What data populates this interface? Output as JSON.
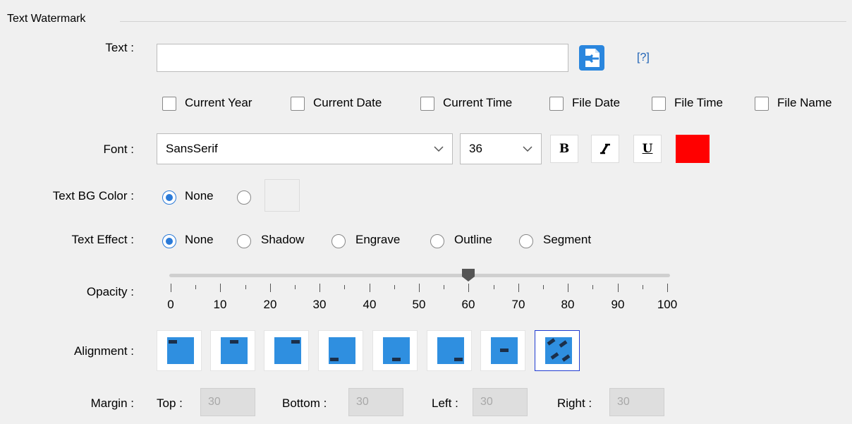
{
  "group_title": "Text Watermark",
  "labels": {
    "text": "Text :",
    "font": "Font :",
    "text_bg_color": "Text BG Color :",
    "text_effect": "Text Effect :",
    "opacity": "Opacity :",
    "alignment": "Alignment :",
    "margin": "Margin :"
  },
  "text_input": {
    "value": ""
  },
  "help_link": "[?]",
  "checkboxes": [
    "Current Year",
    "Current Date",
    "Current Time",
    "File Date",
    "File Time",
    "File Name"
  ],
  "font": {
    "family": "SansSerif",
    "size": "36",
    "bold": "B",
    "italic_icon": "italic-icon",
    "underline": "U",
    "color": "#ff0000"
  },
  "bg_color": {
    "none_label": "None",
    "selected": "None",
    "swatch_color": "#f0f0f0"
  },
  "text_effect": {
    "options": [
      "None",
      "Shadow",
      "Engrave",
      "Outline",
      "Segment"
    ],
    "selected": "None"
  },
  "opacity": {
    "value": 60,
    "min": 0,
    "max": 100,
    "tick_labels": [
      "0",
      "10",
      "20",
      "30",
      "40",
      "50",
      "60",
      "70",
      "80",
      "90",
      "100"
    ]
  },
  "alignment": {
    "selected_index": 7,
    "accent": "#2f8fe0"
  },
  "margin": {
    "top_label": "Top :",
    "top_value": "30",
    "bottom_label": "Bottom :",
    "bottom_value": "30",
    "left_label": "Left :",
    "left_value": "30",
    "right_label": "Right :",
    "right_value": "30"
  }
}
